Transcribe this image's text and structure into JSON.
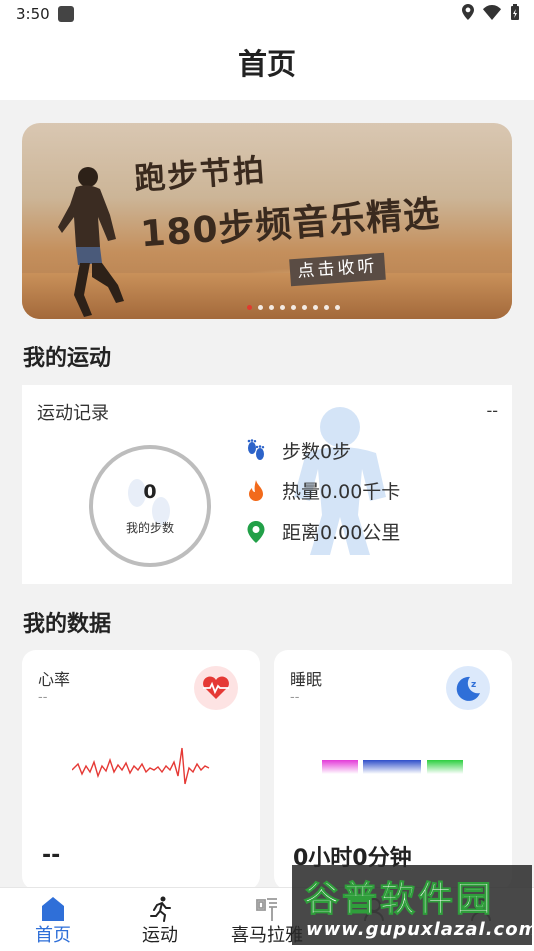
{
  "status_bar": {
    "time": "3:50"
  },
  "header": {
    "title": "首页"
  },
  "banner": {
    "title_line1": "跑步节拍",
    "title_line2": "180步频音乐精选",
    "cta": "点击收听",
    "dots_count": 9,
    "active_dot": 0
  },
  "sport": {
    "section_title": "我的运动",
    "record_title": "运动记录",
    "record_more": "--",
    "steps_value": "0",
    "steps_label": "我的步数",
    "stats": [
      {
        "icon": "footprints-icon",
        "text": "步数0步",
        "color": "#2c63c9"
      },
      {
        "icon": "flame-icon",
        "text": "热量0.00千卡",
        "color": "#f26a1b"
      },
      {
        "icon": "location-pin-icon",
        "text": "距离0.00公里",
        "color": "#22a048"
      }
    ]
  },
  "data_section": {
    "title": "我的数据",
    "heart": {
      "label": "心率",
      "sub": "--",
      "value": "--",
      "icon": "heart-rate-icon",
      "accent": "#e53935"
    },
    "sleep": {
      "label": "睡眠",
      "sub": "--",
      "value": "0小时0分钟",
      "icon": "moon-icon",
      "accent": "#2f6fd8"
    }
  },
  "tabs": [
    {
      "label": "首页",
      "icon": "home-icon",
      "active": true
    },
    {
      "label": "运动",
      "icon": "runner-icon",
      "active": false
    },
    {
      "label": "喜马拉雅",
      "icon": "listen-icon",
      "active": false
    },
    {
      "label": "",
      "icon": "tab-icon-4",
      "active": false
    },
    {
      "label": "",
      "icon": "tab-icon-5",
      "active": false
    }
  ],
  "watermark": {
    "title": "谷普软件园",
    "url": "www.gupuxlazal.com"
  },
  "colors": {
    "accent": "#2f6fd8",
    "background": "#f2f2f2",
    "card": "#ffffff"
  }
}
